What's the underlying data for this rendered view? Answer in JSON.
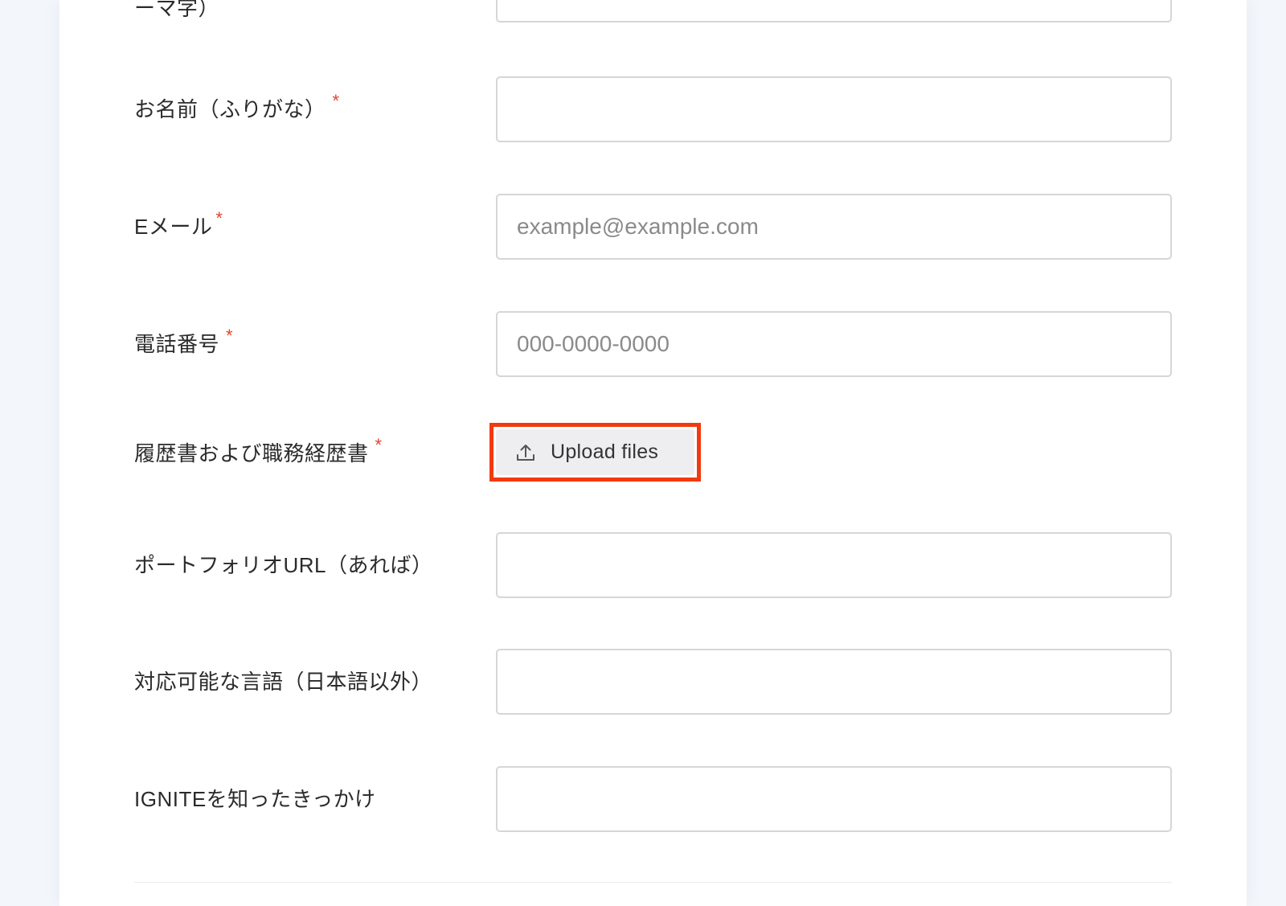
{
  "form": {
    "required_mark": "*",
    "name_romaji": {
      "label": "ーマ字）"
    },
    "name_kana": {
      "label": "お名前（ふりがな）"
    },
    "email": {
      "label": "Eメール",
      "placeholder": "example@example.com"
    },
    "phone": {
      "label": "電話番号",
      "placeholder": "000-0000-0000"
    },
    "resume": {
      "label": "履歴書および職務経歴書",
      "button_label": "Upload files",
      "icon": "upload-icon"
    },
    "portfolio": {
      "label": "ポートフォリオURL（あれば）"
    },
    "languages": {
      "label": "対応可能な言語（日本語以外）"
    },
    "referral": {
      "label": "IGNITEを知ったきっかけ"
    }
  },
  "colors": {
    "required_mark": "#e5432a",
    "highlight_border": "#f23a0f",
    "page_background": "#f3f6fb",
    "input_border": "#d6d6d6",
    "button_background": "#eeeef1"
  }
}
